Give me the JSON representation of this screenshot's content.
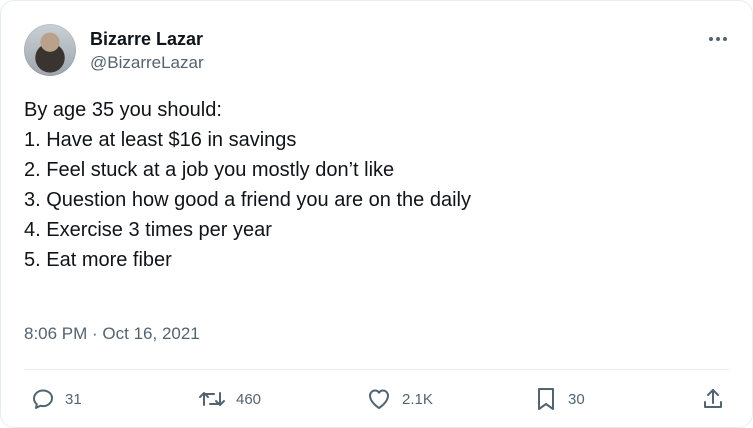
{
  "user": {
    "display_name": "Bizarre Lazar",
    "handle": "@BizarreLazar"
  },
  "tweet": {
    "lines": [
      "By age 35 you should:",
      "",
      "1. Have at least $16 in savings",
      "2. Feel stuck at a job you mostly don’t like",
      "3. Question how good a friend you are on the daily",
      "4. Exercise 3 times per year",
      "5. Eat more fiber"
    ],
    "timestamp": "8:06 PM · Oct 16, 2021"
  },
  "actions": {
    "replies": "31",
    "retweets": "460",
    "likes": "2.1K",
    "bookmarks": "30"
  },
  "icons": {
    "more": "more-horizontal-icon",
    "reply": "reply-icon",
    "retweet": "retweet-icon",
    "like": "heart-icon",
    "bookmark": "bookmark-icon",
    "share": "share-icon"
  }
}
